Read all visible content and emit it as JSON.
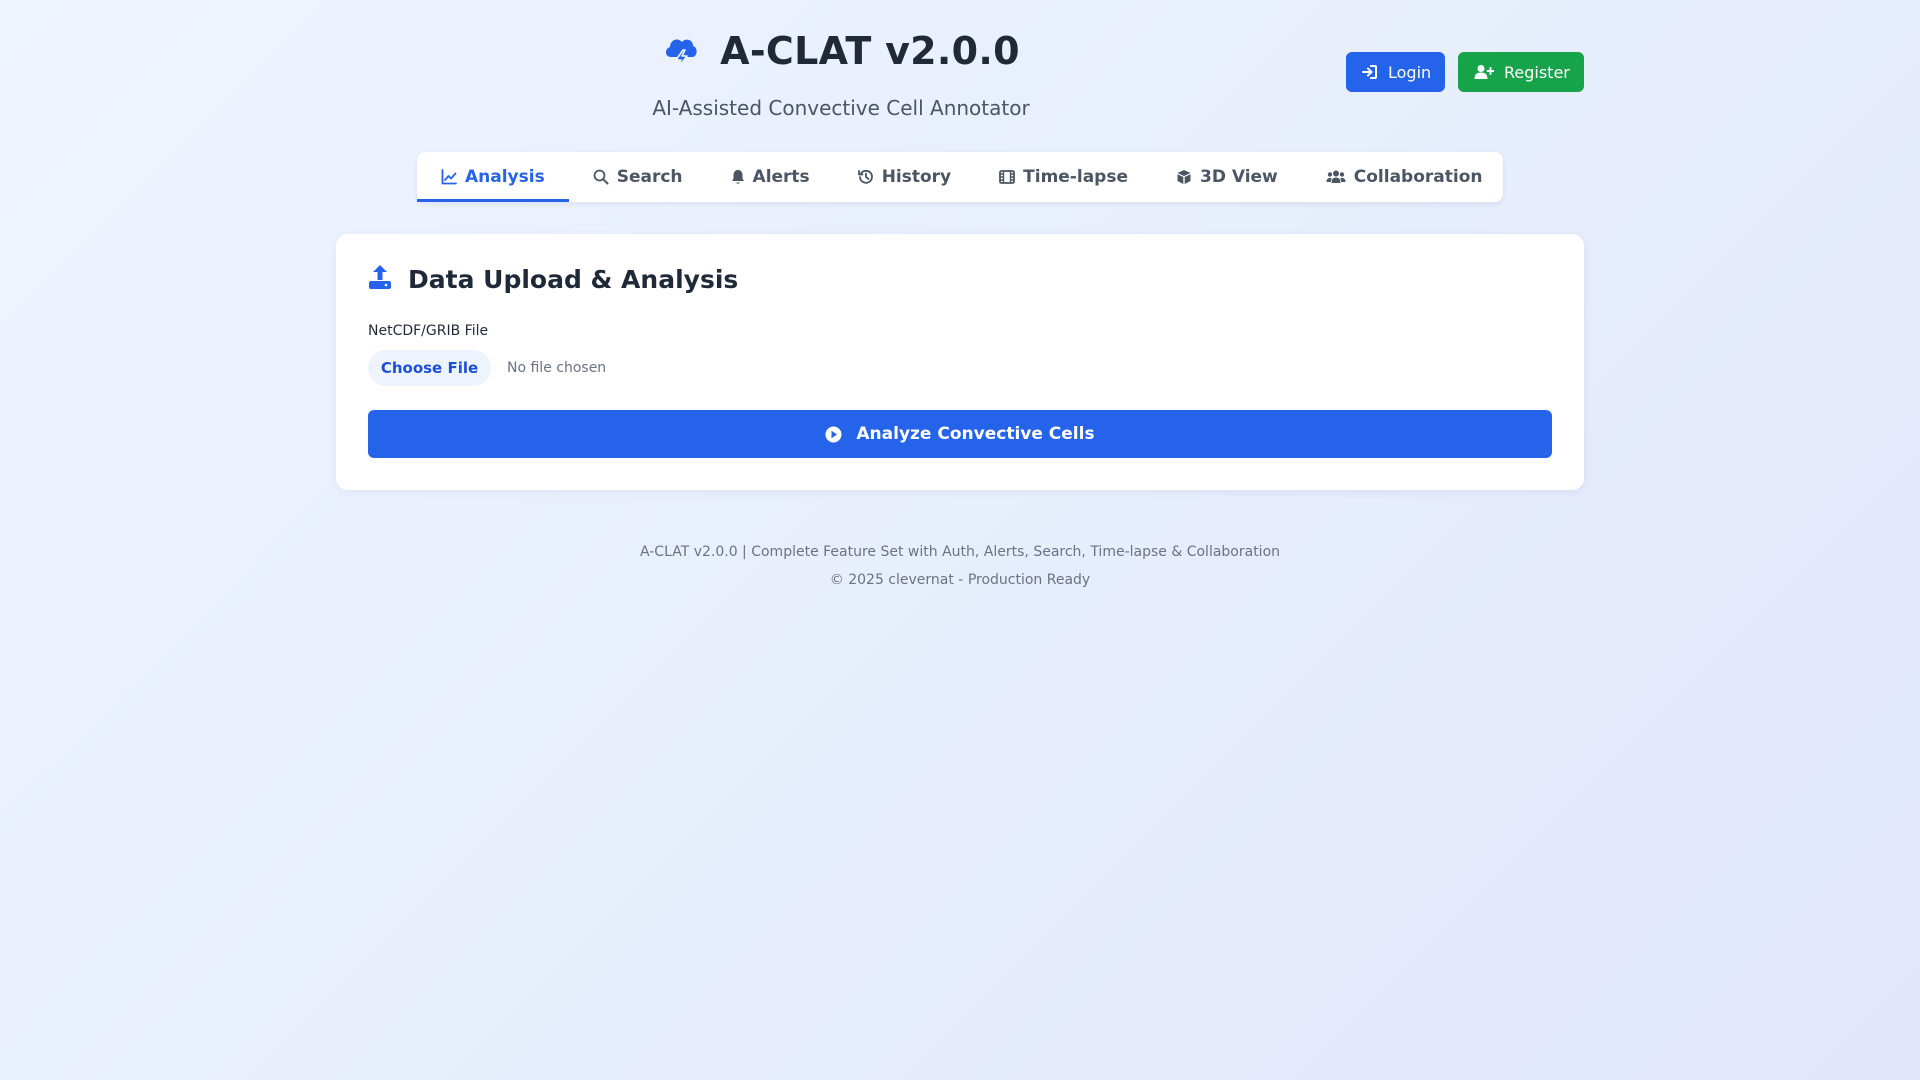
{
  "app": {
    "title": "A-CLAT v2.0.0",
    "subtitle": "AI-Assisted Convective Cell Annotator",
    "logo_icon": "cloud-bolt-icon"
  },
  "auth": {
    "login_label": "Login",
    "login_icon": "sign-in-icon",
    "register_label": "Register",
    "register_icon": "user-plus-icon"
  },
  "tabs": [
    {
      "label": "Analysis",
      "icon": "chart-line-icon",
      "active": true
    },
    {
      "label": "Search",
      "icon": "search-icon",
      "active": false
    },
    {
      "label": "Alerts",
      "icon": "bell-icon",
      "active": false
    },
    {
      "label": "History",
      "icon": "history-icon",
      "active": false
    },
    {
      "label": "Time-lapse",
      "icon": "film-icon",
      "active": false
    },
    {
      "label": "3D View",
      "icon": "cube-icon",
      "active": false
    },
    {
      "label": "Collaboration",
      "icon": "users-icon",
      "active": false
    }
  ],
  "upload": {
    "title": "Data Upload & Analysis",
    "icon": "upload-icon",
    "field_label": "NetCDF/GRIB File",
    "choose_button": "Choose File",
    "file_status": "No file chosen",
    "analyze_button": "Analyze Convective Cells",
    "analyze_icon": "play-circle-icon"
  },
  "footer": {
    "line1": "A-CLAT v2.0.0 | Complete Feature Set with Auth, Alerts, Search, Time-lapse & Collaboration",
    "line2": "© 2025 clevernat - Production Ready"
  },
  "colors": {
    "primary": "#2563eb",
    "success": "#16a34a",
    "text": "#1f2937",
    "muted": "#6b7280"
  }
}
